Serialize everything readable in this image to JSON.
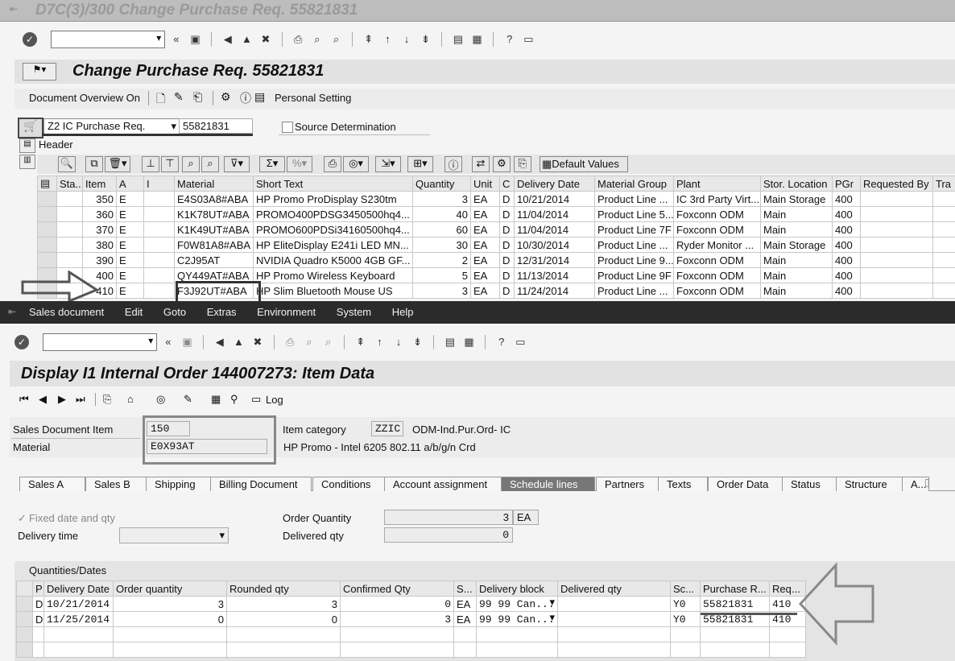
{
  "upper": {
    "window_title": "D7C(3)/300 Change Purchase Req. 55821831",
    "screen_title": "Change Purchase Req. 55821831",
    "app_toolbar": {
      "doc_overview": "Document Overview On",
      "personal_setting": "Personal Setting"
    },
    "doc_type": "Z2 IC Purchase Req.",
    "doc_number": "55821831",
    "source_determination": "Source Determination",
    "header_label": "Header",
    "default_values": "Default Values",
    "columns": [
      "Sta...",
      "Item",
      "A",
      "I",
      "Material",
      "Short Text",
      "Quantity",
      "Unit",
      "C",
      "Delivery Date",
      "Material Group",
      "Plant",
      "Stor. Location",
      "PGr",
      "Requested By",
      "Tra"
    ],
    "rows": [
      {
        "item": "350",
        "a": "E",
        "material": "E4S03A8#ABA",
        "text": "HP Promo ProDisplay S230tm",
        "qty": "3",
        "unit": "EA",
        "c": "D",
        "date": "10/21/2014",
        "group": "Product Line ...",
        "plant": "IC 3rd Party Virt...",
        "stor": "Main Storage",
        "pgr": "400"
      },
      {
        "item": "360",
        "a": "E",
        "material": "K1K78UT#ABA",
        "text": "PROMO400PDSG3450500hq4...",
        "qty": "40",
        "unit": "EA",
        "c": "D",
        "date": "11/04/2014",
        "group": "Product Line 5...",
        "plant": "Foxconn ODM",
        "stor": "Main",
        "pgr": "400"
      },
      {
        "item": "370",
        "a": "E",
        "material": "K1K49UT#ABA",
        "text": "PROMO600PDSi34160500hq4...",
        "qty": "60",
        "unit": "EA",
        "c": "D",
        "date": "11/04/2014",
        "group": "Product Line 7F",
        "plant": "Foxconn ODM",
        "stor": "Main",
        "pgr": "400"
      },
      {
        "item": "380",
        "a": "E",
        "material": "F0W81A8#ABA",
        "text": "HP EliteDisplay E241i LED MN...",
        "qty": "30",
        "unit": "EA",
        "c": "D",
        "date": "10/30/2014",
        "group": "Product Line ...",
        "plant": "Ryder Monitor ...",
        "stor": "Main Storage",
        "pgr": "400"
      },
      {
        "item": "390",
        "a": "E",
        "material": "C2J95AT",
        "text": "NVIDIA Quadro K5000 4GB GF...",
        "qty": "2",
        "unit": "EA",
        "c": "D",
        "date": "12/31/2014",
        "group": "Product Line 9...",
        "plant": "Foxconn ODM",
        "stor": "Main",
        "pgr": "400"
      },
      {
        "item": "400",
        "a": "E",
        "material": "QY449AT#ABA",
        "text": "HP Promo Wireless Keyboard",
        "qty": "5",
        "unit": "EA",
        "c": "D",
        "date": "11/13/2014",
        "group": "Product Line 9F",
        "plant": "Foxconn ODM",
        "stor": "Main",
        "pgr": "400"
      },
      {
        "item": "410",
        "a": "E",
        "material": "F3J92UT#ABA",
        "text": "HP Slim Bluetooth Mouse US",
        "qty": "3",
        "unit": "EA",
        "c": "D",
        "date": "11/24/2014",
        "group": "Product Line ...",
        "plant": "Foxconn ODM",
        "stor": "Main",
        "pgr": "400"
      }
    ]
  },
  "menu": [
    "Sales document",
    "Edit",
    "Goto",
    "Extras",
    "Environment",
    "System",
    "Help"
  ],
  "lower": {
    "screen_title": "Display I1 Internal Order 144007273: Item Data",
    "log_label": "Log",
    "sales_doc_item_label": "Sales Document Item",
    "sales_doc_item": "150",
    "material_label": "Material",
    "material": "E0X93AT",
    "item_category_label": "Item category",
    "item_category": "ZZIC",
    "item_category_text": "ODM-Ind.Pur.Ord- IC",
    "material_desc": "HP Promo - Intel 6205 802.11 a/b/g/n Crd",
    "tabs": [
      "Sales A",
      "Sales B",
      "Shipping",
      "Billing Document",
      "Conditions",
      "Account assignment",
      "Schedule lines",
      "Partners",
      "Texts",
      "Order Data",
      "Status",
      "Structure",
      "A..."
    ],
    "active_tab": "Schedule lines",
    "fixed_date": "Fixed date and qty",
    "delivery_time_label": "Delivery time",
    "order_qty_label": "Order Quantity",
    "order_qty": "3",
    "order_qty_unit": "EA",
    "delivered_qty_label": "Delivered qty",
    "delivered_qty": "0",
    "qd_title": "Quantities/Dates",
    "columns": [
      "P",
      "Delivery Date",
      "Order quantity",
      "Rounded qty",
      "Confirmed Qty",
      "S...",
      "Delivery block",
      "Delivered qty",
      "Sc...",
      "Purchase R...",
      "Req..."
    ],
    "rows": [
      {
        "p": "D",
        "date": "10/21/2014",
        "order": "3",
        "rounded": "3",
        "confirmed": "0",
        "s": "EA",
        "block": "99 99 Can...",
        "delivered": "",
        "sc": "Y0",
        "pr": "55821831",
        "req": "410"
      },
      {
        "p": "D",
        "date": "11/25/2014",
        "order": "0",
        "rounded": "0",
        "confirmed": "3",
        "s": "EA",
        "block": "99 99 Can...",
        "delivered": "",
        "sc": "Y0",
        "pr": "55821831",
        "req": "410"
      }
    ]
  }
}
